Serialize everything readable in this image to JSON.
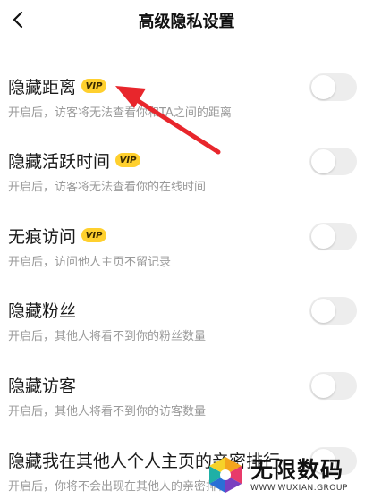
{
  "header": {
    "title": "高级隐私设置"
  },
  "vip_badge": "VIP",
  "settings": [
    {
      "title": "隐藏距离",
      "vip": true,
      "desc": "开启后，访客将无法查看你和TA之间的距离",
      "enabled": false
    },
    {
      "title": "隐藏活跃时间",
      "vip": true,
      "desc": "开启后，访客将无法查看你的在线时间",
      "enabled": false
    },
    {
      "title": "无痕访问",
      "vip": true,
      "desc": "开启后，访问他人主页不留记录",
      "enabled": false
    },
    {
      "title": "隐藏粉丝",
      "vip": false,
      "desc": "开启后，其他人将看不到你的粉丝数量",
      "enabled": false
    },
    {
      "title": "隐藏访客",
      "vip": false,
      "desc": "开启后，其他人将看不到你的访客数量",
      "enabled": false
    },
    {
      "title": "隐藏我在其他人个人主页的亲密排行",
      "vip": false,
      "desc": "开启后，你将不会出现在其他人的亲密排行",
      "enabled": false
    }
  ],
  "watermark": {
    "name": "无限数码",
    "url": "WWW.WUXIAN.GROUP"
  },
  "colors": {
    "vip_badge": "#ffd02e",
    "toggle_off": "#ededed",
    "arrow": "#e8262c",
    "subtext": "#9a9a9a"
  }
}
